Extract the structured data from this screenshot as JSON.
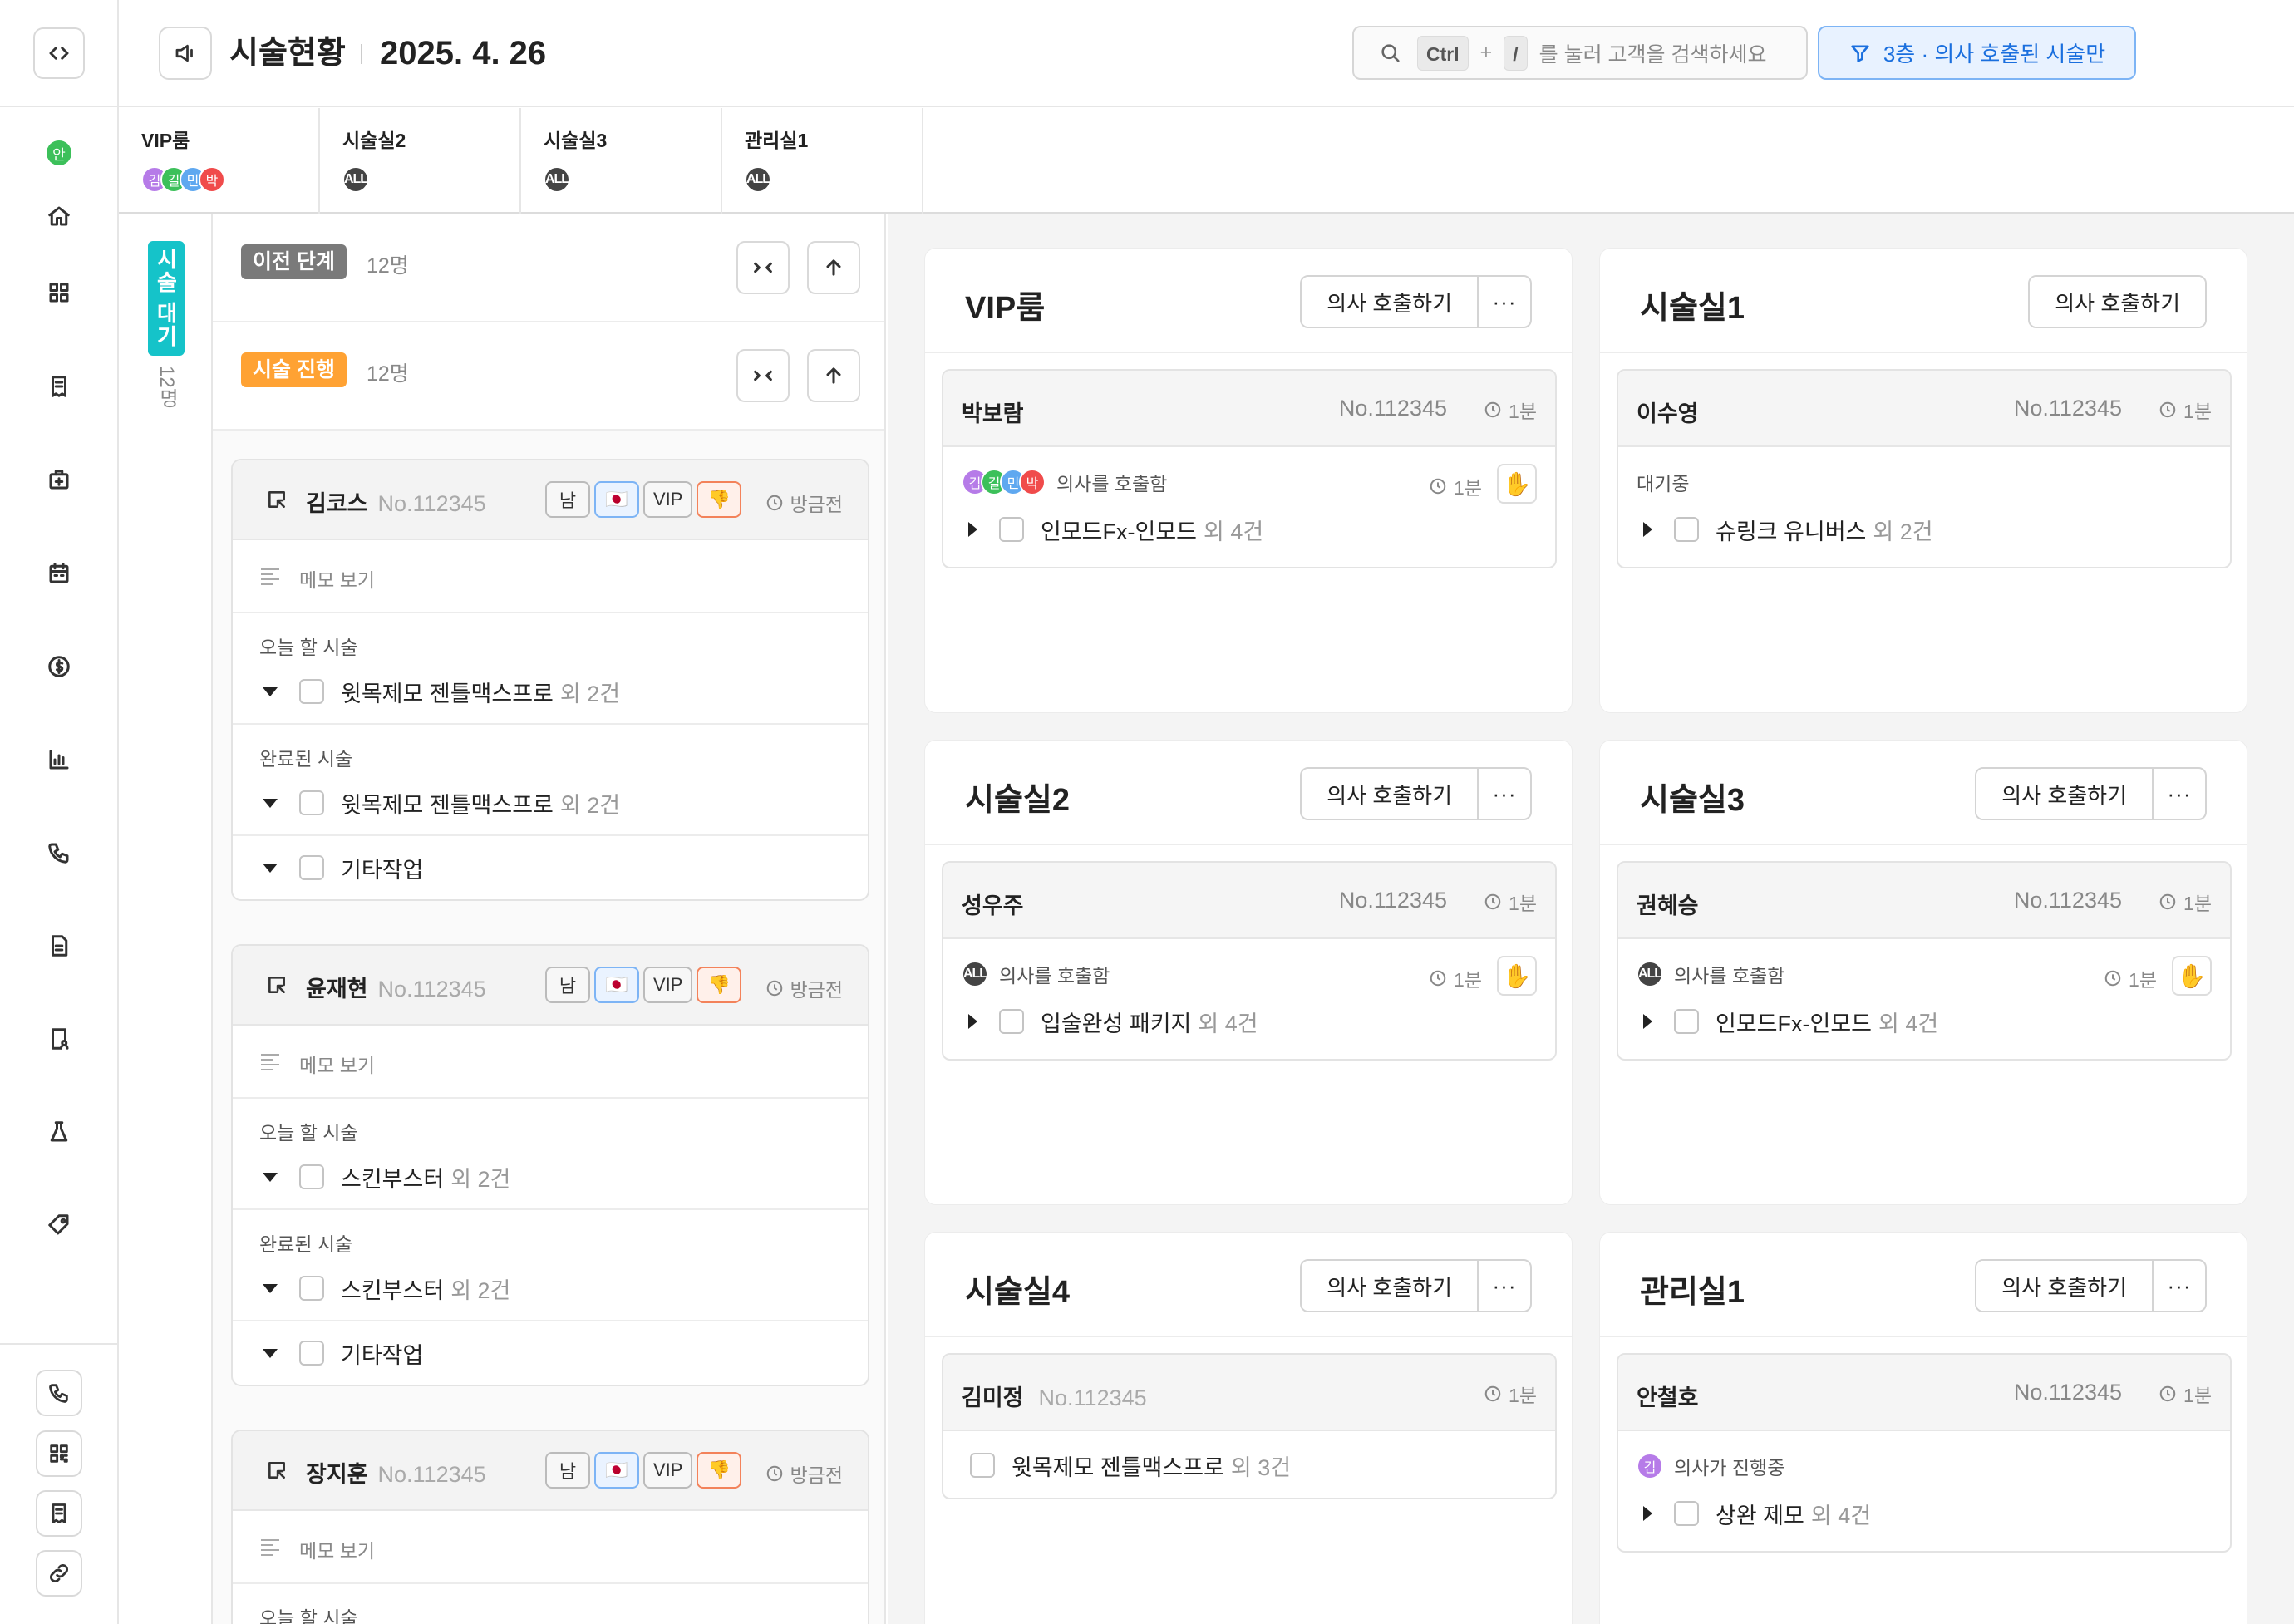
{
  "header": {
    "title": "시술현황",
    "date": "2025. 4. 26",
    "search": {
      "key1": "Ctrl",
      "plus": "+",
      "key2": "/",
      "hint": "를 눌러 고객을 검색하세요"
    },
    "filter_label": "3층 · 의사 호출된 시술만"
  },
  "nav": {
    "online_badge": "안",
    "items": [
      "code-toggle-icon",
      "home-icon",
      "grid-icon",
      "receipt-icon",
      "medical-box-icon",
      "calendar-icon",
      "dollar-icon",
      "chart-icon",
      "phone-icon",
      "document-icon",
      "person-doc-icon",
      "flask-icon",
      "tag-icon"
    ],
    "bottom": [
      "phone-icon",
      "qr-icon",
      "receipt-icon",
      "link-icon"
    ]
  },
  "room_tabs": [
    {
      "name": "VIP룸",
      "avatars": [
        {
          "t": "김",
          "c": "#b67be8"
        },
        {
          "t": "길",
          "c": "#3cc05a"
        },
        {
          "t": "민",
          "c": "#5fa8f0"
        },
        {
          "t": "박",
          "c": "#f04b4b"
        }
      ]
    },
    {
      "name": "시술실2",
      "avatars": [
        {
          "t": "ALL",
          "c": "#444"
        }
      ]
    },
    {
      "name": "시술실3",
      "avatars": [
        {
          "t": "ALL",
          "c": "#444"
        }
      ]
    },
    {
      "name": "관리실1",
      "avatars": [
        {
          "t": "ALL",
          "c": "#444"
        }
      ]
    }
  ],
  "waiting": {
    "label": "시술 대기",
    "count": "12명"
  },
  "stages": [
    {
      "label": "이전 단계",
      "count": "12명",
      "color": "#7a7a7a"
    },
    {
      "label": "시술 진행",
      "count": "12명",
      "color": "#ffa233"
    }
  ],
  "patients": [
    {
      "name": "김코스",
      "no": "No.112345",
      "badges": [
        "남",
        "🇯🇵",
        "VIP",
        "👎"
      ],
      "state": "방금전",
      "memo": "메모 보기",
      "today_label": "오늘 할 시술",
      "today": {
        "name": "윗목제모 젠틀맥스프로",
        "more": "외 2건"
      },
      "done_label": "완료된 시술",
      "done": {
        "name": "윗목제모 젠틀맥스프로",
        "more": "외 2건"
      },
      "extra": "기타작업"
    },
    {
      "name": "윤재현",
      "no": "No.112345",
      "badges": [
        "남",
        "🇯🇵",
        "VIP",
        "👎"
      ],
      "state": "방금전",
      "memo": "메모 보기",
      "today_label": "오늘 할 시술",
      "today": {
        "name": "스킨부스터",
        "more": "외 2건"
      },
      "done_label": "완료된 시술",
      "done": {
        "name": "스킨부스터",
        "more": "외 2건"
      },
      "extra": "기타작업"
    },
    {
      "name": "장지훈",
      "no": "No.112345",
      "badges": [
        "남",
        "🇯🇵",
        "VIP",
        "👎"
      ],
      "state": "방금전",
      "memo": "메모 보기",
      "today_label": "오늘 할 시술"
    }
  ],
  "call_label": "의사 호출하기",
  "more_label": "···",
  "rooms": [
    {
      "title": "VIP룸",
      "has_more": true,
      "patient": {
        "name": "박보람",
        "no": "No.112345",
        "time": "1분",
        "status": "의사를 호출함",
        "avatars": [
          {
            "t": "김",
            "c": "#b67be8"
          },
          {
            "t": "길",
            "c": "#3cc05a"
          },
          {
            "t": "민",
            "c": "#5fa8f0"
          },
          {
            "t": "박",
            "c": "#f04b4b"
          }
        ],
        "status_time": "1분",
        "hand": true,
        "proc": "인모드Fx-인모드",
        "more": "외 4건"
      }
    },
    {
      "title": "시술실1",
      "has_more": false,
      "patient": {
        "name": "이수영",
        "no": "No.112345",
        "time": "1분",
        "status": "대기중",
        "avatars": [],
        "status_time": "",
        "hand": false,
        "proc": "슈링크 유니버스",
        "more": "외 2건"
      }
    },
    {
      "title": "시술실2",
      "has_more": true,
      "patient": {
        "name": "성우주",
        "no": "No.112345",
        "time": "1분",
        "status": "의사를 호출함",
        "avatars": [
          {
            "t": "ALL",
            "c": "#444"
          }
        ],
        "status_time": "1분",
        "hand": true,
        "proc": "입술완성 패키지",
        "more": "외 4건"
      }
    },
    {
      "title": "시술실3",
      "has_more": true,
      "patient": {
        "name": "권혜승",
        "no": "No.112345",
        "time": "1분",
        "status": "의사를 호출함",
        "avatars": [
          {
            "t": "ALL",
            "c": "#444"
          }
        ],
        "status_time": "1분",
        "hand": true,
        "proc": "인모드Fx-인모드",
        "more": "외 4건"
      }
    },
    {
      "title": "시술실4",
      "has_more": true,
      "patient": {
        "name": "김미정",
        "no": "No.112345",
        "time": "1분",
        "status": "",
        "avatars": [],
        "status_time": "",
        "hand": false,
        "proc": "윗목제모 젠틀맥스프로",
        "more": "외 3건",
        "inline_no": true,
        "no_caret": true
      }
    },
    {
      "title": "관리실1",
      "has_more": true,
      "patient": {
        "name": "안철호",
        "no": "No.112345",
        "time": "1분",
        "status": "의사가 진행중",
        "avatars": [
          {
            "t": "김",
            "c": "#b67be8"
          }
        ],
        "status_time": "",
        "hand": false,
        "proc": "상완 제모",
        "more": "외 4건"
      }
    }
  ]
}
